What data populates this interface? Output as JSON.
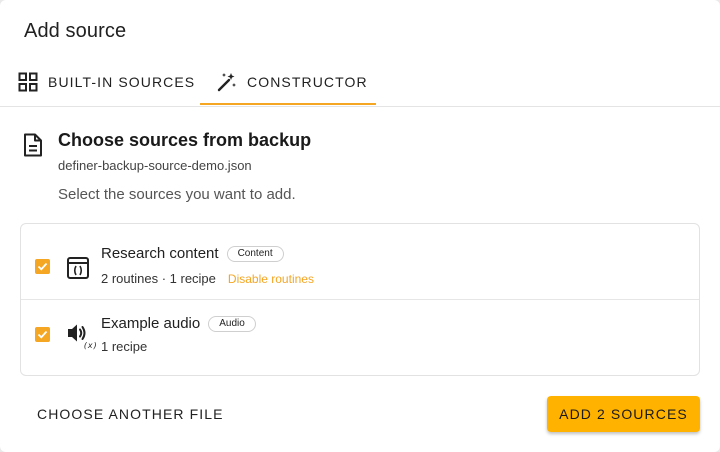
{
  "dialog": {
    "title": "Add source"
  },
  "tabs": [
    {
      "label": "BUILT-IN SOURCES",
      "icon": "grid-icon",
      "active": false
    },
    {
      "label": "CONSTRUCTOR",
      "icon": "magic-wand-icon",
      "active": true
    }
  ],
  "colors": {
    "accent": "#f5a623",
    "primary_button": "#ffb300"
  },
  "section": {
    "icon": "document-icon",
    "heading": "Choose sources from backup",
    "file_name": "definer-backup-source-demo.json",
    "instruction": "Select the sources you want to add."
  },
  "sources": [
    {
      "title": "Research content",
      "badge": "Content",
      "meta": "2 routines · 1 recipe",
      "link": "Disable routines",
      "icon": "code-window-icon",
      "checked": true
    },
    {
      "title": "Example audio",
      "badge": "Audio",
      "meta": "1 recipe",
      "icon": "audio-variable-icon",
      "icon_mark": "(x)",
      "checked": true
    }
  ],
  "actions": {
    "secondary": "CHOOSE ANOTHER FILE",
    "primary": "ADD 2 SOURCES"
  }
}
